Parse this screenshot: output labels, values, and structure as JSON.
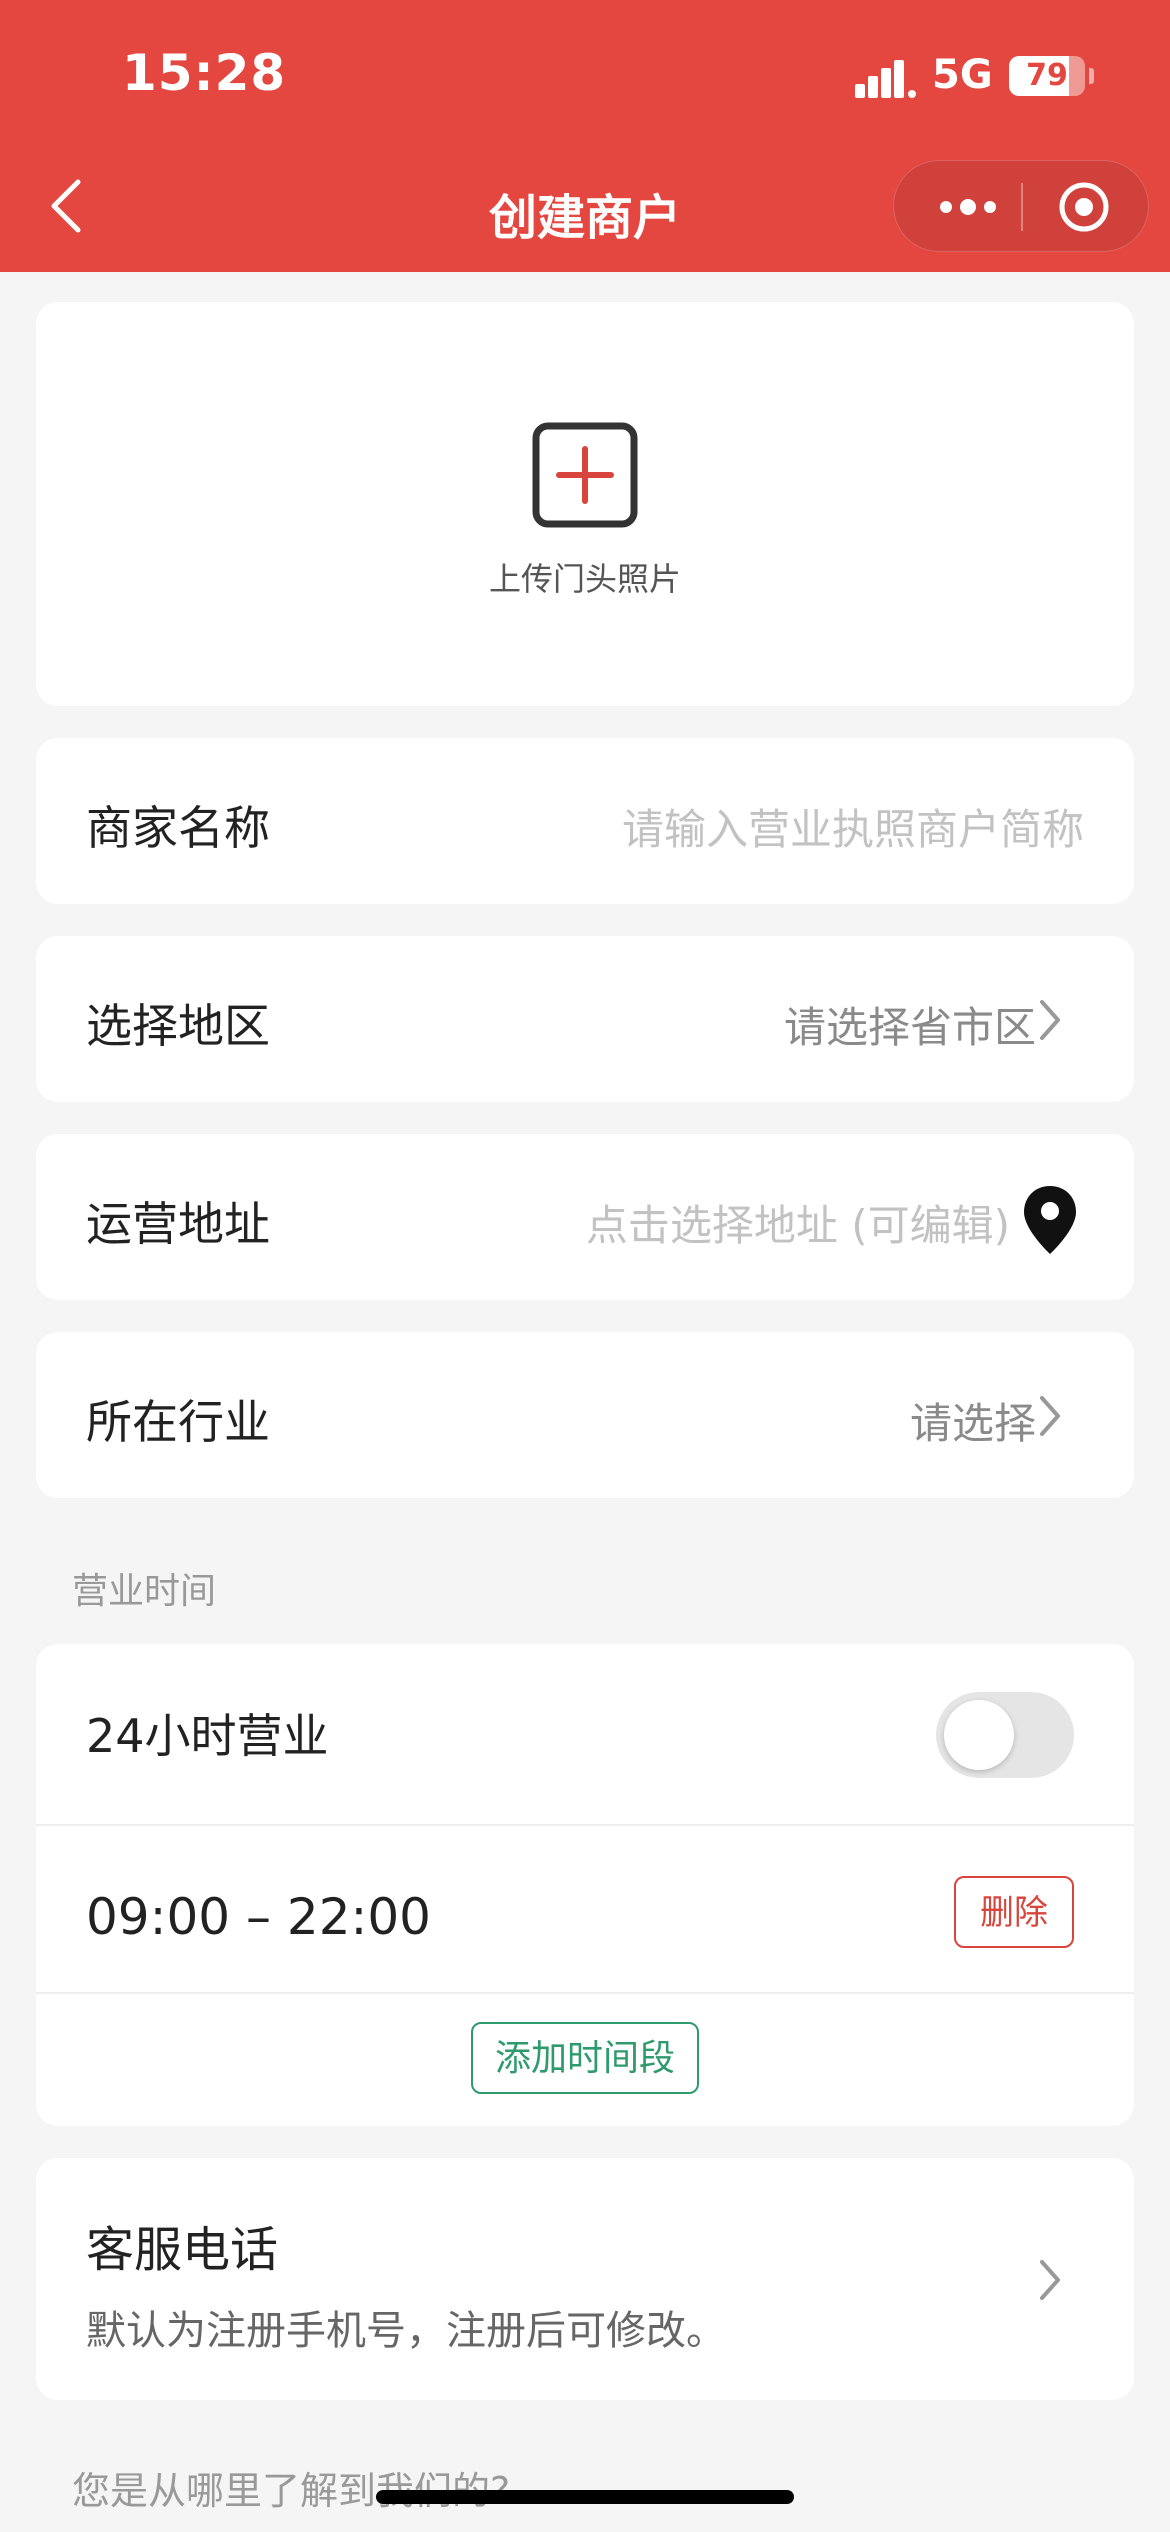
{
  "status_bar": {
    "time": "15:28",
    "network": "5G",
    "battery": 79
  },
  "nav": {
    "title": "创建商户"
  },
  "upload": {
    "label": "上传门头照片"
  },
  "form": {
    "merchant_name": {
      "label": "商家名称",
      "placeholder": "请输入营业执照商户简称"
    },
    "region": {
      "label": "选择地区",
      "placeholder": "请选择省市区"
    },
    "address": {
      "label": "运营地址",
      "placeholder": "点击选择地址 (可编辑)"
    },
    "industry": {
      "label": "所在行业",
      "placeholder": "请选择"
    }
  },
  "business_hours": {
    "section_title": "营业时间",
    "open_24h": {
      "label": "24小时营业",
      "enabled": false
    },
    "time_range": "09:00 – 22:00",
    "delete_label": "删除",
    "add_label": "添加时间段"
  },
  "customer_service": {
    "title": "客服电话",
    "subtitle": "默认为注册手机号，注册后可修改。"
  },
  "footer_question": "您是从哪里了解到我们的?",
  "colors": {
    "brand": "#e34740",
    "danger": "#d8453c",
    "success": "#2e9a6e"
  }
}
